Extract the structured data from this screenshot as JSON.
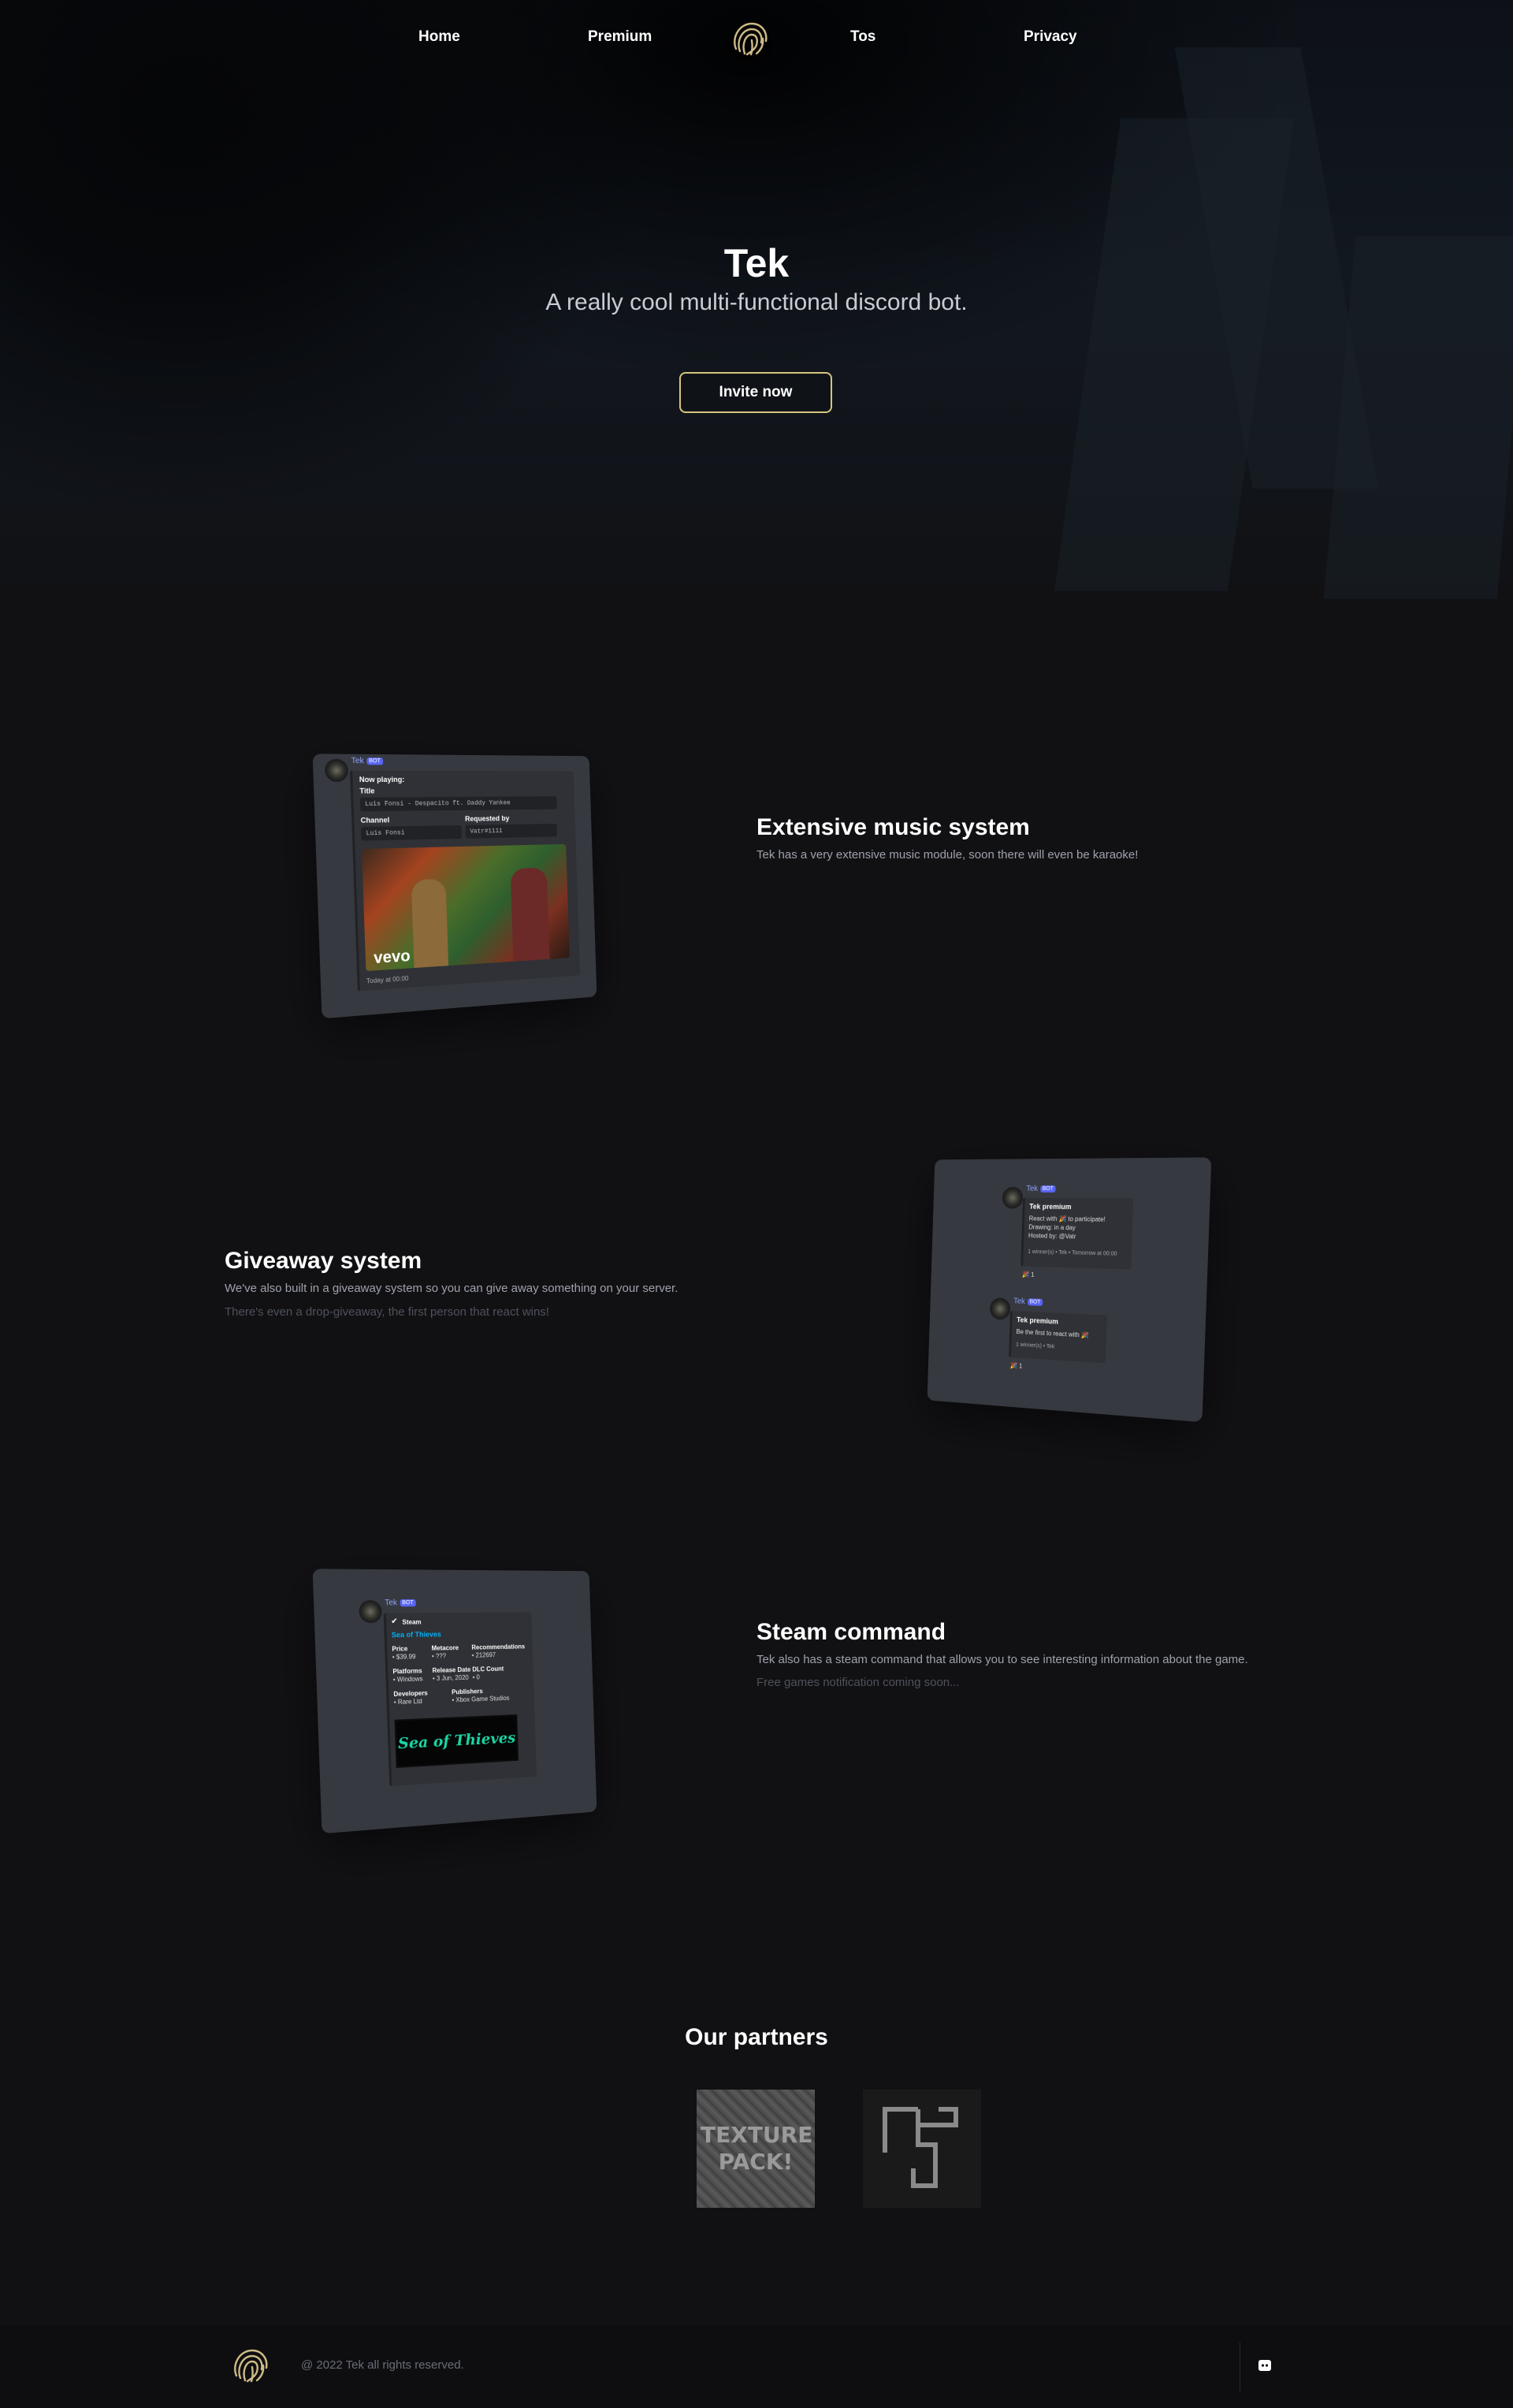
{
  "nav": {
    "home": "Home",
    "premium": "Premium",
    "tos": "Tos",
    "privacy": "Privacy",
    "logo_icon": "fingerprint-logo"
  },
  "hero": {
    "title": "Tek",
    "subtitle": "A really cool multi-functional discord bot.",
    "invite_label": "Invite now"
  },
  "colors": {
    "accent": "#d7c57e",
    "background": "#111114",
    "card": "#36393f",
    "discord_blurple": "#5865f2",
    "teal_accent": "#1abc9c"
  },
  "features": [
    {
      "title": "Extensive music system",
      "desc": "Tek has a very extensive music module, soon there will even be karaoke!",
      "note": ""
    },
    {
      "title": "Giveaway system",
      "desc": "We've also built in a giveaway system so you can give away something on your server.",
      "note": "There's even a drop-giveaway, the first person that react wins!"
    },
    {
      "title": "Steam command",
      "desc": "Tek also has a steam command that allows you to see interesting information about the game.",
      "note": "Free games notification coming soon..."
    }
  ],
  "music_card": {
    "bot_name": "Tek",
    "bot_tag": "BOT",
    "now_playing": "Now playing:",
    "title_label": "Title",
    "title_value": "Luis Fonsi - Despacito ft. Daddy Yankee",
    "channel_label": "Channel",
    "channel_value": "Luis Fonsi",
    "requested_label": "Requested by",
    "requested_value": "Vatr#1111",
    "thumb_text": "vevo",
    "footer": "Today at 00:00"
  },
  "giveaway_card": {
    "bot_name": "Tek",
    "bot_tag": "BOT",
    "g1_title": "Tek premium",
    "g1_line1": "React with 🎉 to participate!",
    "g1_line2": "Drawing: in a day",
    "g1_line3": "Hosted by: @Vatr",
    "g1_footer": "1 winner(s) • Tek • Tomorrow at 00:00",
    "g1_reaction": "🎉 1",
    "g2_title": "Tek premium",
    "g2_line1": "Be the first to react with 🎉",
    "g2_footer": "1 winner(s) • Tek",
    "g2_reaction": "🎉 1"
  },
  "steam_card": {
    "bot_name": "Tek",
    "bot_tag": "BOT",
    "author": "Steam",
    "game": "Sea of Thieves",
    "price_label": "Price",
    "price_value": "• $39.99",
    "meta_label": "Metacore",
    "meta_value": "• ???",
    "rec_label": "Recommendations",
    "rec_value": "• 212697",
    "plat_label": "Platforms",
    "plat_value": "• Windows",
    "release_label": "Release Date",
    "release_value": "• 3 Jun, 2020",
    "dlc_label": "DLC Count",
    "dlc_value": "• 0",
    "dev_label": "Developers",
    "dev_value": "• Rare Ltd",
    "pub_label": "Publishers",
    "pub_value": "• Xbox Game Studios",
    "banner_text": "Sea of Thieves"
  },
  "partners": {
    "title": "Our partners",
    "p1_text": "TEXTURE PACK!",
    "p2_icon": "ts-logo"
  },
  "footer": {
    "copyright": "@ 2022 Tek all rights reserved.",
    "discord_icon": "discord-icon"
  }
}
